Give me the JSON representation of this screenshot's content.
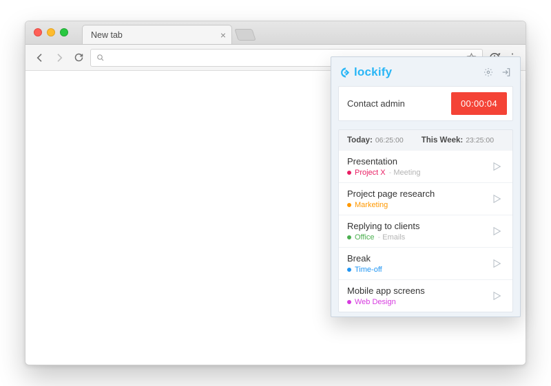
{
  "browser": {
    "tab_title": "New tab",
    "omnibox_value": ""
  },
  "popup": {
    "brand": "lockify",
    "current_task": "Contact admin",
    "timer": "00:00:04",
    "summary": {
      "today_label": "Today:",
      "today_value": "06:25:00",
      "week_label": "This Week:",
      "week_value": "23:25:00"
    },
    "entries": [
      {
        "title": "Presentation",
        "project": "Project X",
        "project_color": "#e91e63",
        "tag": "Meeting"
      },
      {
        "title": "Project page research",
        "project": "Marketing",
        "project_color": "#ff9800",
        "tag": ""
      },
      {
        "title": "Replying to clients",
        "project": "Office",
        "project_color": "#4caf50",
        "tag": "Emails"
      },
      {
        "title": "Break",
        "project": "Time-off",
        "project_color": "#2196f3",
        "tag": ""
      },
      {
        "title": "Mobile app screens",
        "project": "Web Design",
        "project_color": "#d63adf",
        "tag": ""
      }
    ]
  }
}
